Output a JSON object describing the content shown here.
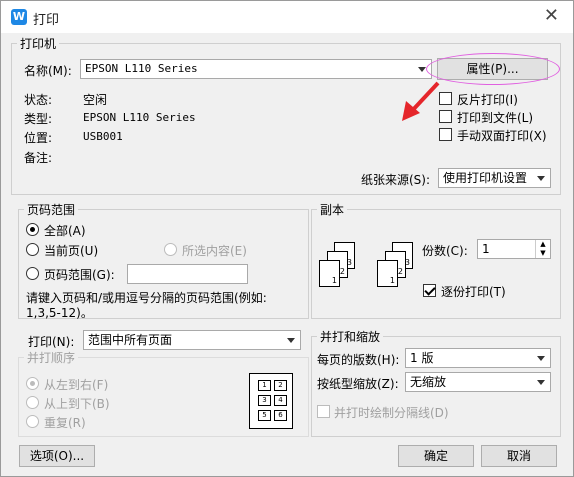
{
  "window": {
    "title": "打印",
    "app_icon": "W"
  },
  "printer": {
    "group_label": "打印机",
    "name_label": "名称(M):",
    "name_value": "EPSON L110 Series",
    "properties_button": "属性(P)...",
    "status_label": "状态:",
    "status_value": "空闲",
    "type_label": "类型:",
    "type_value": "EPSON L110 Series",
    "location_label": "位置:",
    "location_value": "USB001",
    "comment_label": "备注:",
    "reverse_print": "反片打印(I)",
    "print_to_file": "打印到文件(L)",
    "manual_duplex": "手动双面打印(X)",
    "paper_source_label": "纸张来源(S):",
    "paper_source_value": "使用打印机设置"
  },
  "page_range": {
    "group_label": "页码范围",
    "all": "全部(A)",
    "current": "当前页(U)",
    "selection": "所选内容(E)",
    "pages": "页码范围(G):",
    "hint_line1": "请键入页码和/或用逗号分隔的页码范围(例如:",
    "hint_line2": "1,3,5-12)。"
  },
  "copies": {
    "group_label": "副本",
    "count_label": "份数(C):",
    "count_value": "1",
    "collate": "逐份打印(T)"
  },
  "print_what": {
    "label": "打印(N):",
    "value": "范围中所有页面"
  },
  "order": {
    "group_label": "并打顺序",
    "left_to_right": "从左到右(F)",
    "top_to_bottom": "从上到下(B)",
    "repeat": "重复(R)",
    "grid_numbers": [
      "1",
      "2",
      "3",
      "4",
      "5",
      "6"
    ]
  },
  "zoom": {
    "group_label": "并打和缩放",
    "pages_per_sheet_label": "每页的版数(H):",
    "pages_per_sheet_value": "1 版",
    "scale_label": "按纸型缩放(Z):",
    "scale_value": "无缩放",
    "draw_separator": "并打时绘制分隔线(D)"
  },
  "buttons": {
    "options": "选项(O)...",
    "ok": "确定",
    "cancel": "取消"
  },
  "annotation": {
    "highlight_color": "#e060e0",
    "arrow_color": "#e5262b"
  }
}
